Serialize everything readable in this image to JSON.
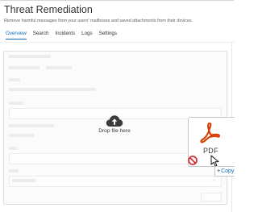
{
  "header": {
    "title": "Threat Remediation",
    "subtitle": "Remove harmful messages from your users' mailboxes and saved attachments from their devices."
  },
  "tabs": [
    {
      "label": "Overview",
      "active": true
    },
    {
      "label": "Search",
      "active": false
    },
    {
      "label": "Incidents",
      "active": false
    },
    {
      "label": "Logs",
      "active": false
    },
    {
      "label": "Settings",
      "active": false
    }
  ],
  "dropzone": {
    "label": "Drop file here",
    "icon": "cloud-upload-icon"
  },
  "drag_preview": {
    "file_label": "PDF",
    "icon": "pdf-file-icon",
    "badge_icon": "no-drop-icon",
    "copy_label": "Copy"
  },
  "colors": {
    "accent": "#0f6cbd",
    "pdf_red": "#d83b01",
    "text": "#323130"
  }
}
